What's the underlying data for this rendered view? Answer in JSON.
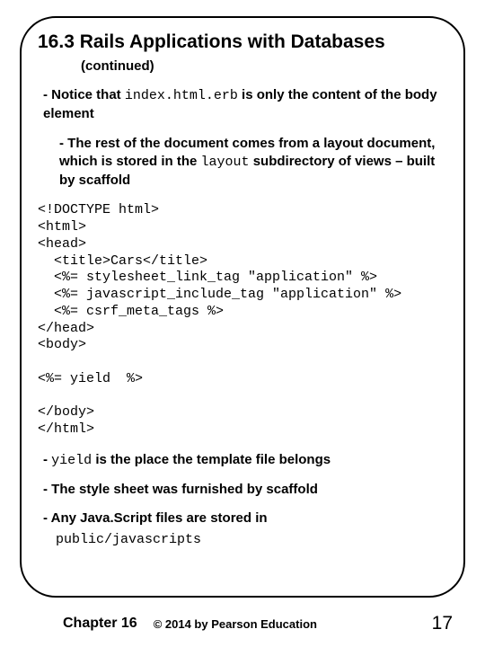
{
  "title": "16.3 Rails Applications with Databases",
  "continued": "(continued)",
  "bullet1_pre": "- Notice that ",
  "bullet1_code": "index.html.erb",
  "bullet1_post": " is only the content of the body element",
  "bullet2_pre": "- The rest of the document comes from a layout document, which is stored in the ",
  "bullet2_code": "layout",
  "bullet2_post": " subdirectory of views – built by scaffold",
  "code": "<!DOCTYPE html>\n<html>\n<head>\n  <title>Cars</title>\n  <%= stylesheet_link_tag \"application\" %>\n  <%= javascript_include_tag \"application\" %>\n  <%= csrf_meta_tags %>\n</head>\n<body>\n\n<%= yield  %>\n\n</body>\n</html>",
  "bullet3_pre": "- ",
  "bullet3_code": "yield",
  "bullet3_post": " is the place the template file belongs",
  "bullet4": "- The style sheet was furnished by scaffold",
  "bullet5": "- Any Java.Script files are stored in",
  "bullet5_code": "public/javascripts",
  "footer_chapter": "Chapter 16",
  "footer_copy": "© 2014 by Pearson Education",
  "footer_page": "17"
}
